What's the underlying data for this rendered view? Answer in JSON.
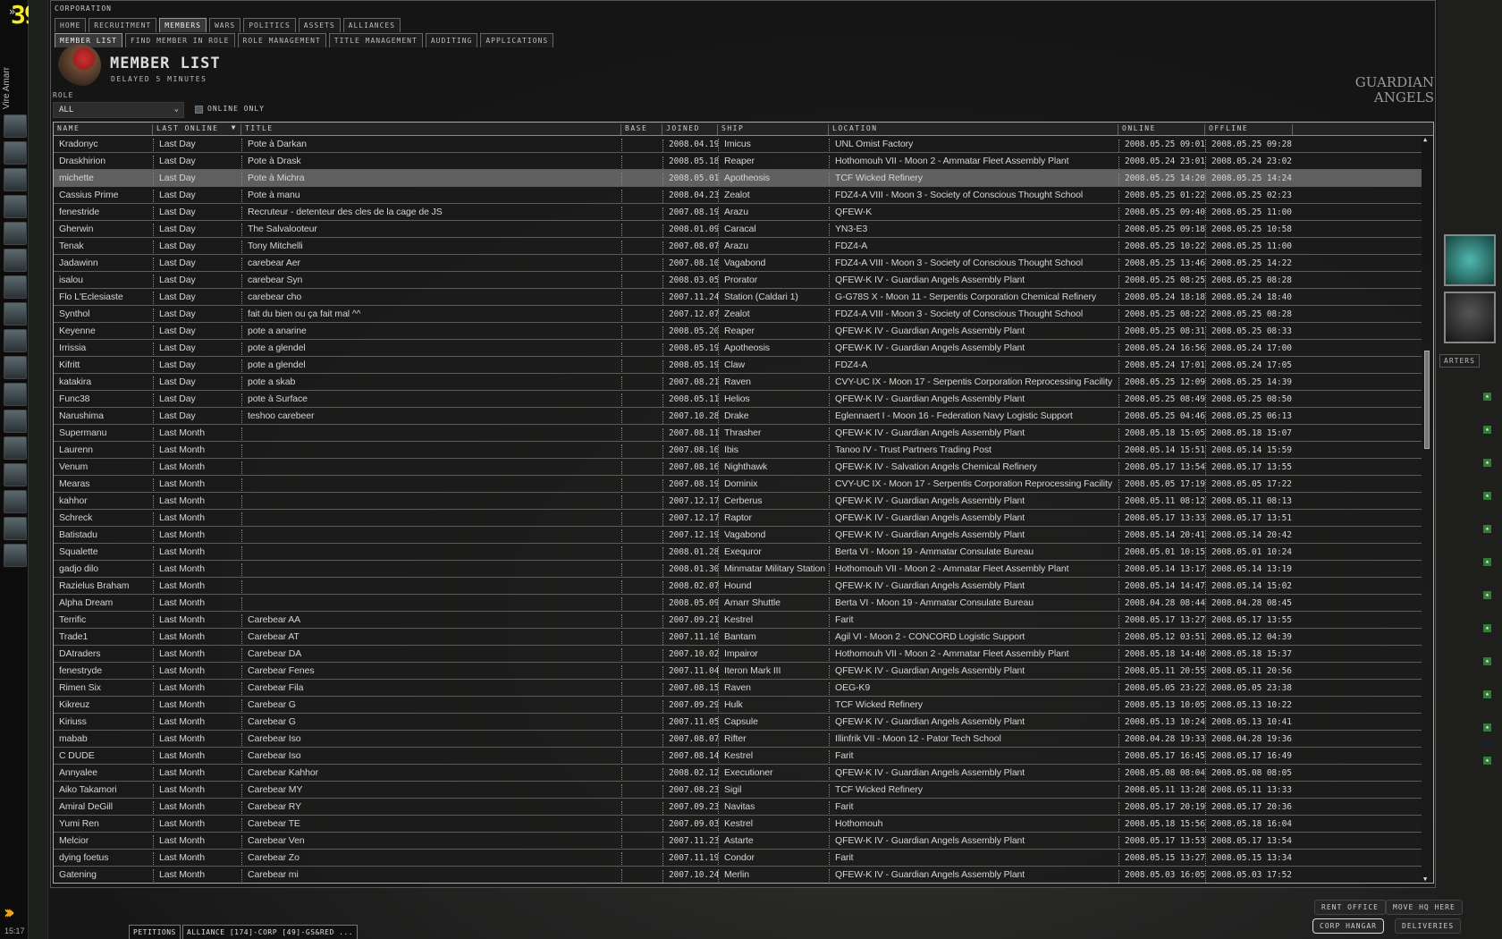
{
  "neocom": {
    "level": "39",
    "character": "Vire Amarr",
    "clock": "15:17",
    "icon_count": 17
  },
  "window": {
    "title": "CORPORATION",
    "tabs": [
      "HOME",
      "RECRUITMENT",
      "MEMBERS",
      "WARS",
      "POLITICS",
      "ASSETS",
      "ALLIANCES"
    ],
    "active_tab": 2,
    "subtabs": [
      "MEMBER LIST",
      "FIND MEMBER IN ROLE",
      "ROLE MANAGEMENT",
      "TITLE MANAGEMENT",
      "AUDITING",
      "APPLICATIONS"
    ],
    "active_subtab": 0,
    "header": {
      "title": "MEMBER LIST",
      "subtitle": "DELAYED 5 MINUTES"
    },
    "filters": {
      "role_label": "ROLE",
      "role_value": "ALL",
      "online_only_label": "ONLINE ONLY",
      "online_only": false
    },
    "columns": [
      "NAME",
      "LAST ONLINE",
      "TITLE",
      "BASE",
      "JOINED",
      "SHIP",
      "LOCATION",
      "ONLINE",
      "OFFLINE"
    ],
    "sort_column": "LAST ONLINE",
    "selected_row": 2,
    "rows": [
      [
        "Kradonyc",
        "Last Day",
        "Pote à Darkan",
        "",
        "2008.04.19",
        "Imicus",
        "UNL Omist Factory",
        "2008.05.25 09:01",
        "2008.05.25 09:28"
      ],
      [
        "Draskhirion",
        "Last Day",
        "Pote à Drask",
        "",
        "2008.05.18",
        "Reaper",
        "Hothomouh VII - Moon 2 - Ammatar Fleet Assembly Plant",
        "2008.05.24 23:01",
        "2008.05.24 23:02"
      ],
      [
        "michette",
        "Last Day",
        "Pote à Michra",
        "",
        "2008.05.01",
        "Apotheosis",
        "TCF Wicked Refinery",
        "2008.05.25 14:20",
        "2008.05.25 14:24"
      ],
      [
        "Cassius Prime",
        "Last Day",
        "Pote à manu",
        "",
        "2008.04.23",
        "Zealot",
        "FDZ4-A VIII - Moon 3 - Society of Conscious Thought School",
        "2008.05.25 01:22",
        "2008.05.25 02:23"
      ],
      [
        "fenestride",
        "Last Day",
        "Recruteur - detenteur des cles de la cage de JS",
        "",
        "2007.08.19",
        "Arazu",
        "QFEW-K",
        "2008.05.25 09:40",
        "2008.05.25 11:00"
      ],
      [
        "Gherwin",
        "Last Day",
        "The Salvalooteur",
        "",
        "2008.01.09",
        "Caracal",
        "YN3-E3",
        "2008.05.25 09:18",
        "2008.05.25 10:58"
      ],
      [
        "Tenak",
        "Last Day",
        "Tony Mitchelli",
        "",
        "2007.08.07",
        "Arazu",
        "FDZ4-A",
        "2008.05.25 10:22",
        "2008.05.25 11:00"
      ],
      [
        "Jadawinn",
        "Last Day",
        "carebear Aer",
        "",
        "2007.08.10",
        "Vagabond",
        "FDZ4-A VIII - Moon 3 - Society of Conscious Thought School",
        "2008.05.25 13:46",
        "2008.05.25 14:22"
      ],
      [
        "isalou",
        "Last Day",
        "carebear Syn",
        "",
        "2008.03.05",
        "Prorator",
        "QFEW-K IV - Guardian Angels Assembly Plant",
        "2008.05.25 08:25",
        "2008.05.25 08:28"
      ],
      [
        "Flo L'Eclesiaste",
        "Last Day",
        "carebear cho",
        "",
        "2007.11.24",
        "Station (Caldari 1)",
        "G-G78S X - Moon 11 - Serpentis Corporation Chemical Refinery",
        "2008.05.24 18:18",
        "2008.05.24 18:40"
      ],
      [
        "Synthol",
        "Last Day",
        "fait du bien ou ça fait mal ^^",
        "",
        "2007.12.07",
        "Zealot",
        "FDZ4-A VIII - Moon 3 - Society of Conscious Thought School",
        "2008.05.25 08:22",
        "2008.05.25 08:28"
      ],
      [
        "Keyenne",
        "Last Day",
        "pote a anarine",
        "",
        "2008.05.20",
        "Reaper",
        "QFEW-K IV - Guardian Angels Assembly Plant",
        "2008.05.25 08:31",
        "2008.05.25 08:33"
      ],
      [
        "Irrissia",
        "Last Day",
        "pote a glendel",
        "",
        "2008.05.19",
        "Apotheosis",
        "QFEW-K IV - Guardian Angels Assembly Plant",
        "2008.05.24 16:56",
        "2008.05.24 17:00"
      ],
      [
        "Kifritt",
        "Last Day",
        "pote a glendel",
        "",
        "2008.05.19",
        "Claw",
        "FDZ4-A",
        "2008.05.24 17:01",
        "2008.05.24 17:05"
      ],
      [
        "katakira",
        "Last Day",
        "pote a skab",
        "",
        "2007.08.21",
        "Raven",
        "CVY-UC IX - Moon 17 - Serpentis Corporation Reprocessing Facility",
        "2008.05.25 12:09",
        "2008.05.25 14:39"
      ],
      [
        "Func38",
        "Last Day",
        "pote à Surface",
        "",
        "2008.05.11",
        "Helios",
        "QFEW-K IV - Guardian Angels Assembly Plant",
        "2008.05.25 08:49",
        "2008.05.25 08:50"
      ],
      [
        "Narushima",
        "Last Day",
        "teshoo carebeer",
        "",
        "2007.10.28",
        "Drake",
        "Eglennaert I - Moon 16 - Federation Navy Logistic Support",
        "2008.05.25 04:46",
        "2008.05.25 06:13"
      ],
      [
        "Supermanu",
        "Last Month",
        "",
        "",
        "2007.08.11",
        "Thrasher",
        "QFEW-K IV - Guardian Angels Assembly Plant",
        "2008.05.18 15:05",
        "2008.05.18 15:07"
      ],
      [
        "Laurenn",
        "Last Month",
        "",
        "",
        "2007.08.16",
        "Ibis",
        "Tanoo IV - Trust Partners Trading Post",
        "2008.05.14 15:51",
        "2008.05.14 15:59"
      ],
      [
        "Venum",
        "Last Month",
        "",
        "",
        "2007.08.16",
        "Nighthawk",
        "QFEW-K IV - Salvation Angels Chemical Refinery",
        "2008.05.17 13:54",
        "2008.05.17 13:55"
      ],
      [
        "Mearas",
        "Last Month",
        "",
        "",
        "2007.08.19",
        "Dominix",
        "CVY-UC IX - Moon 17 - Serpentis Corporation Reprocessing Facility",
        "2008.05.05 17:19",
        "2008.05.05 17:22"
      ],
      [
        "kahhor",
        "Last Month",
        "",
        "",
        "2007.12.17",
        "Cerberus",
        "QFEW-K IV - Guardian Angels Assembly Plant",
        "2008.05.11 08:12",
        "2008.05.11 08:13"
      ],
      [
        "Schreck",
        "Last Month",
        "",
        "",
        "2007.12.17",
        "Raptor",
        "QFEW-K IV - Guardian Angels Assembly Plant",
        "2008.05.17 13:33",
        "2008.05.17 13:51"
      ],
      [
        "Batistadu",
        "Last Month",
        "",
        "",
        "2007.12.19",
        "Vagabond",
        "QFEW-K IV - Guardian Angels Assembly Plant",
        "2008.05.14 20:41",
        "2008.05.14 20:42"
      ],
      [
        "Squalette",
        "Last Month",
        "",
        "",
        "2008.01.28",
        "Exequror",
        "Berta VI - Moon 19 - Ammatar Consulate Bureau",
        "2008.05.01 10:15",
        "2008.05.01 10:24"
      ],
      [
        "gadjo dilo",
        "Last Month",
        "",
        "",
        "2008.01.30",
        "Minmatar Military Station",
        "Hothomouh VII - Moon 2 - Ammatar Fleet Assembly Plant",
        "2008.05.14 13:17",
        "2008.05.14 13:19"
      ],
      [
        "Razielus Braham",
        "Last Month",
        "",
        "",
        "2008.02.07",
        "Hound",
        "QFEW-K IV - Guardian Angels Assembly Plant",
        "2008.05.14 14:47",
        "2008.05.14 15:02"
      ],
      [
        "Alpha Dream",
        "Last Month",
        "",
        "",
        "2008.05.09",
        "Amarr Shuttle",
        "Berta VI - Moon 19 - Ammatar Consulate Bureau",
        "2008.04.28 08:44",
        "2008.04.28 08:45"
      ],
      [
        "Terrific",
        "Last Month",
        "Carebear AA",
        "",
        "2007.09.21",
        "Kestrel",
        "Farit",
        "2008.05.17 13:27",
        "2008.05.17 13:55"
      ],
      [
        "Trade1",
        "Last Month",
        "Carebear AT",
        "",
        "2007.11.10",
        "Bantam",
        "Agil VI - Moon 2 - CONCORD Logistic Support",
        "2008.05.12 03:51",
        "2008.05.12 04:39"
      ],
      [
        "DAtraders",
        "Last Month",
        "Carebear DA",
        "",
        "2007.10.02",
        "Impairor",
        "Hothomouh VII - Moon 2 - Ammatar Fleet Assembly Plant",
        "2008.05.18 14:40",
        "2008.05.18 15:37"
      ],
      [
        "fenestryde",
        "Last Month",
        "Carebear Fenes",
        "",
        "2007.11.04",
        "Iteron Mark III",
        "QFEW-K IV - Guardian Angels Assembly Plant",
        "2008.05.11 20:55",
        "2008.05.11 20:56"
      ],
      [
        "Rimen Six",
        "Last Month",
        "Carebear Fila",
        "",
        "2007.08.15",
        "Raven",
        "OEG-K9",
        "2008.05.05 23:22",
        "2008.05.05 23:38"
      ],
      [
        "Kikreuz",
        "Last Month",
        "Carebear G",
        "",
        "2007.09.29",
        "Hulk",
        "TCF Wicked Refinery",
        "2008.05.13 10:05",
        "2008.05.13 10:22"
      ],
      [
        "Kiriuss",
        "Last Month",
        "Carebear G",
        "",
        "2007.11.05",
        "Capsule",
        "QFEW-K IV - Guardian Angels Assembly Plant",
        "2008.05.13 10:24",
        "2008.05.13 10:41"
      ],
      [
        "mabab",
        "Last Month",
        "Carebear Iso",
        "",
        "2007.08.07",
        "Rifter",
        "Illinfrik VII - Moon 12 - Pator Tech School",
        "2008.04.28 19:33",
        "2008.04.28 19:36"
      ],
      [
        "C DUDE",
        "Last Month",
        "Carebear Iso",
        "",
        "2007.08.14",
        "Kestrel",
        "Farit",
        "2008.05.17 16:45",
        "2008.05.17 16:49"
      ],
      [
        "Annyalee",
        "Last Month",
        "Carebear Kahhor",
        "",
        "2008.02.12",
        "Executioner",
        "QFEW-K IV - Guardian Angels Assembly Plant",
        "2008.05.08 08:04",
        "2008.05.08 08:05"
      ],
      [
        "Aiko Takamori",
        "Last Month",
        "Carebear MY",
        "",
        "2007.08.23",
        "Sigil",
        "TCF Wicked Refinery",
        "2008.05.11 13:28",
        "2008.05.11 13:33"
      ],
      [
        "Amiral DeGill",
        "Last Month",
        "Carebear RY",
        "",
        "2007.09.23",
        "Navitas",
        "Farit",
        "2008.05.17 20:19",
        "2008.05.17 20:36"
      ],
      [
        "Yumi Ren",
        "Last Month",
        "Carebear TE",
        "",
        "2007.09.03",
        "Kestrel",
        "Hothomouh",
        "2008.05.18 15:56",
        "2008.05.18 16:04"
      ],
      [
        "Melcior",
        "Last Month",
        "Carebear Ven",
        "",
        "2007.11.23",
        "Astarte",
        "QFEW-K IV - Guardian Angels Assembly Plant",
        "2008.05.17 13:53",
        "2008.05.17 13:54"
      ],
      [
        "dying foetus",
        "Last Month",
        "Carebear Zo",
        "",
        "2007.11.19",
        "Condor",
        "Farit",
        "2008.05.15 13:27",
        "2008.05.15 13:34"
      ],
      [
        "Gatening",
        "Last Month",
        "Carebear mi",
        "",
        "2007.10.24",
        "Merlin",
        "QFEW-K IV - Guardian Angels Assembly Plant",
        "2008.05.03 16:05",
        "2008.05.03 17:52"
      ]
    ]
  },
  "station": {
    "logo": "GUARDIAN ANGELS",
    "tab_fragment": "ARTERS",
    "buttons": {
      "rent_office": "RENT OFFICE",
      "move_hq": "MOVE HQ HERE",
      "corp_hangar": "CORP HANGAR",
      "deliveries": "DELIVERIES"
    }
  },
  "taskbar": {
    "petitions": "PETITIONS",
    "alliance": "ALLIANCE [174]-CORP [49]-GS&RED ..."
  },
  "colors": {
    "level": "#f4e82a",
    "selected_row": "#787878",
    "accent_chevrons": "#f3a41c"
  }
}
